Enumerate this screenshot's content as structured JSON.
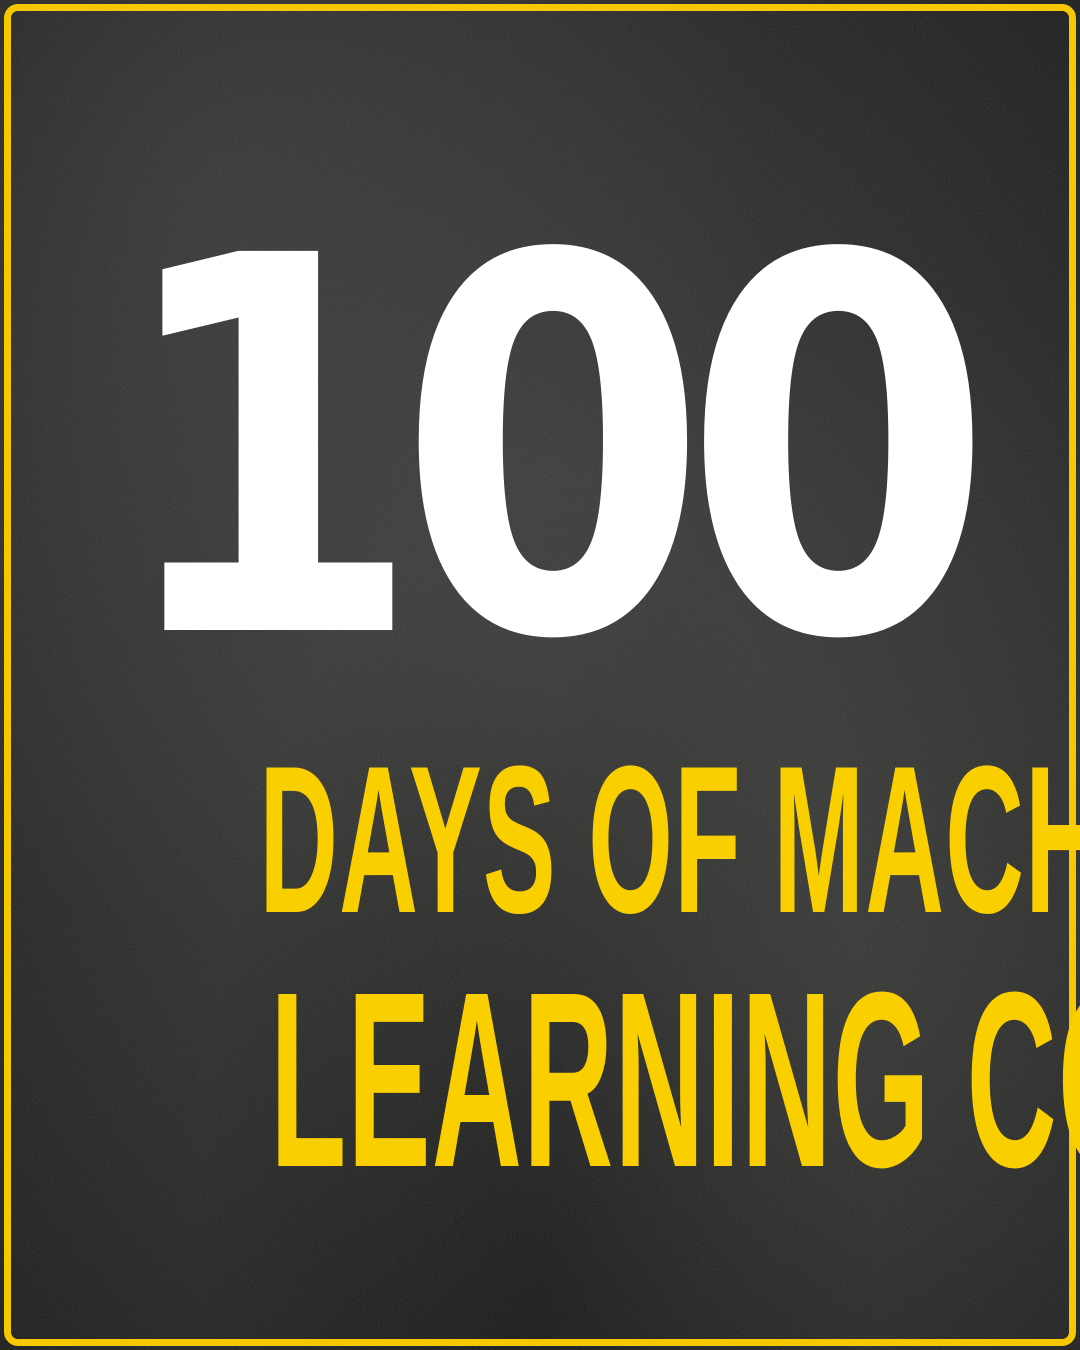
{
  "poster": {
    "number": "100",
    "line1": "DAYS OF MACHINE",
    "line2": "LEARNING CODE"
  },
  "colors": {
    "background": "#262624",
    "frame": "#f5c800",
    "number": "#ffffff",
    "headline": "#f9cf00"
  }
}
